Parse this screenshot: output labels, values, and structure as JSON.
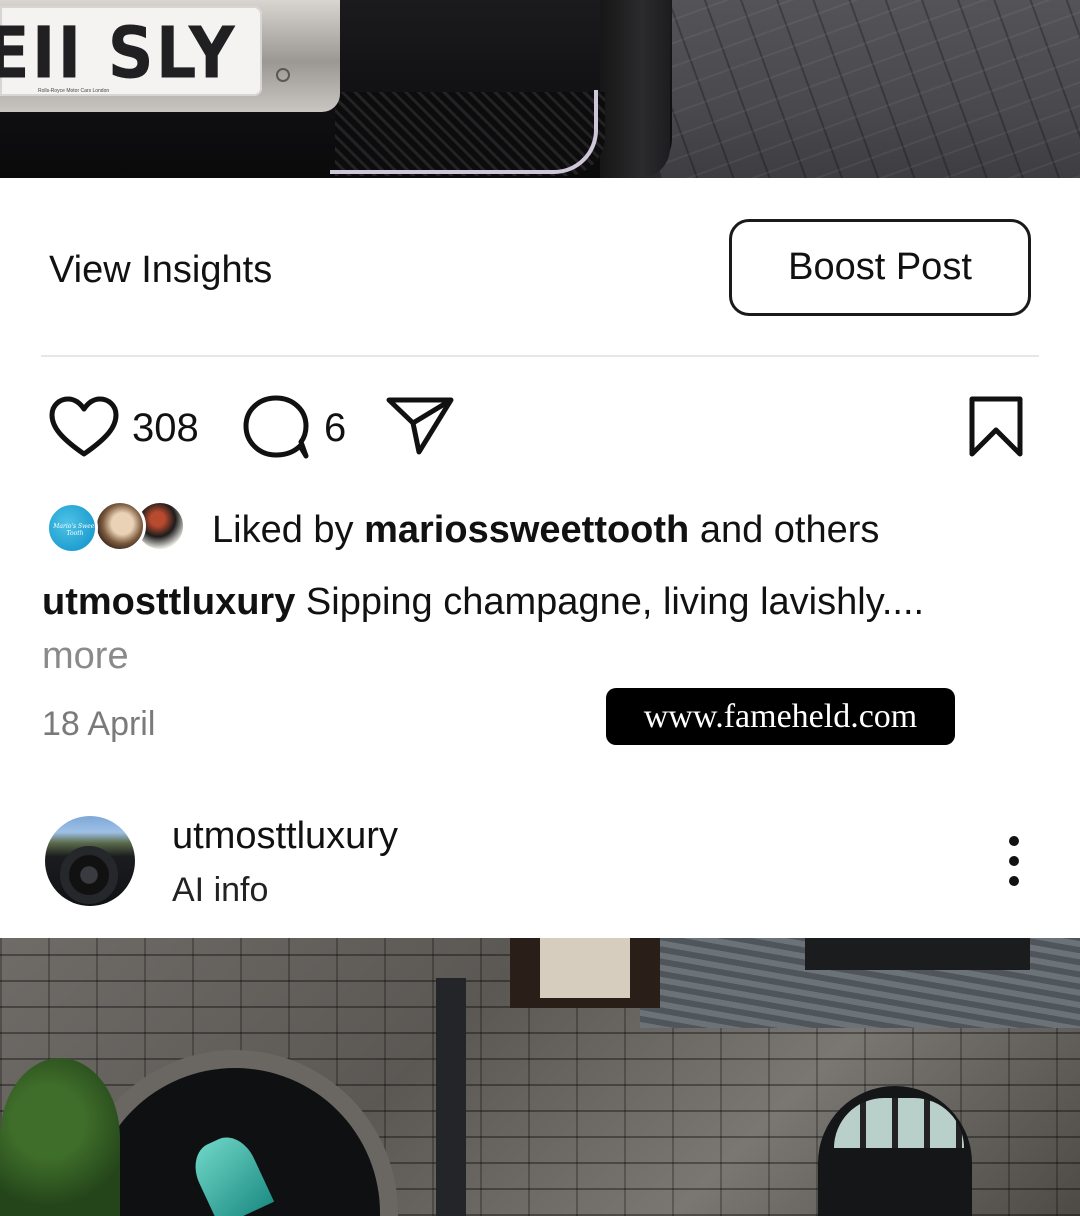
{
  "top_post": {
    "plate_text": "EII SLY",
    "plate_dealer": "Rolls-Royce Motor Cars London"
  },
  "actions": {
    "view_insights": "View Insights",
    "boost_post": "Boost Post"
  },
  "engagement": {
    "like_icon": "heart-icon",
    "like_count": "308",
    "comment_icon": "comment-icon",
    "comment_count": "6",
    "share_icon": "send-icon",
    "save_icon": "bookmark-icon"
  },
  "liked_by": {
    "prefix": "Liked by ",
    "username": "mariossweettooth",
    "suffix": " and others",
    "avatar1_text": "Mario's Sweet Tooth"
  },
  "caption": {
    "username": "utmosttluxury",
    "text": " Sipping champagne, living lavishly....",
    "more": "more"
  },
  "post_date": "18 April",
  "watermark": "www.fameheld.com",
  "next_post": {
    "username": "utmosttluxury",
    "subtitle": "AI info",
    "menu_icon": "more-vertical-icon"
  }
}
